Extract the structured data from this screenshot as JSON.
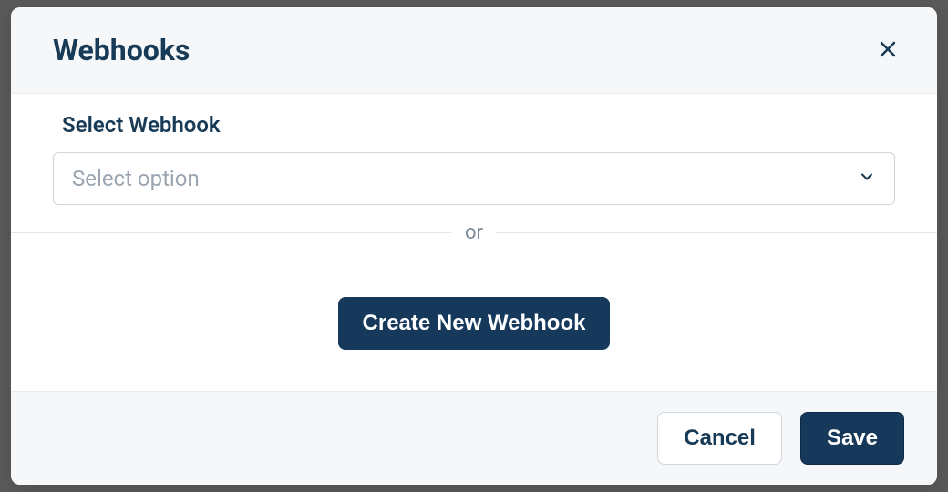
{
  "modal": {
    "title": "Webhooks",
    "body": {
      "field_label": "Select Webhook",
      "select_placeholder": "Select option",
      "divider_text": "or",
      "create_button_label": "Create New Webhook"
    },
    "footer": {
      "cancel_label": "Cancel",
      "save_label": "Save"
    }
  }
}
